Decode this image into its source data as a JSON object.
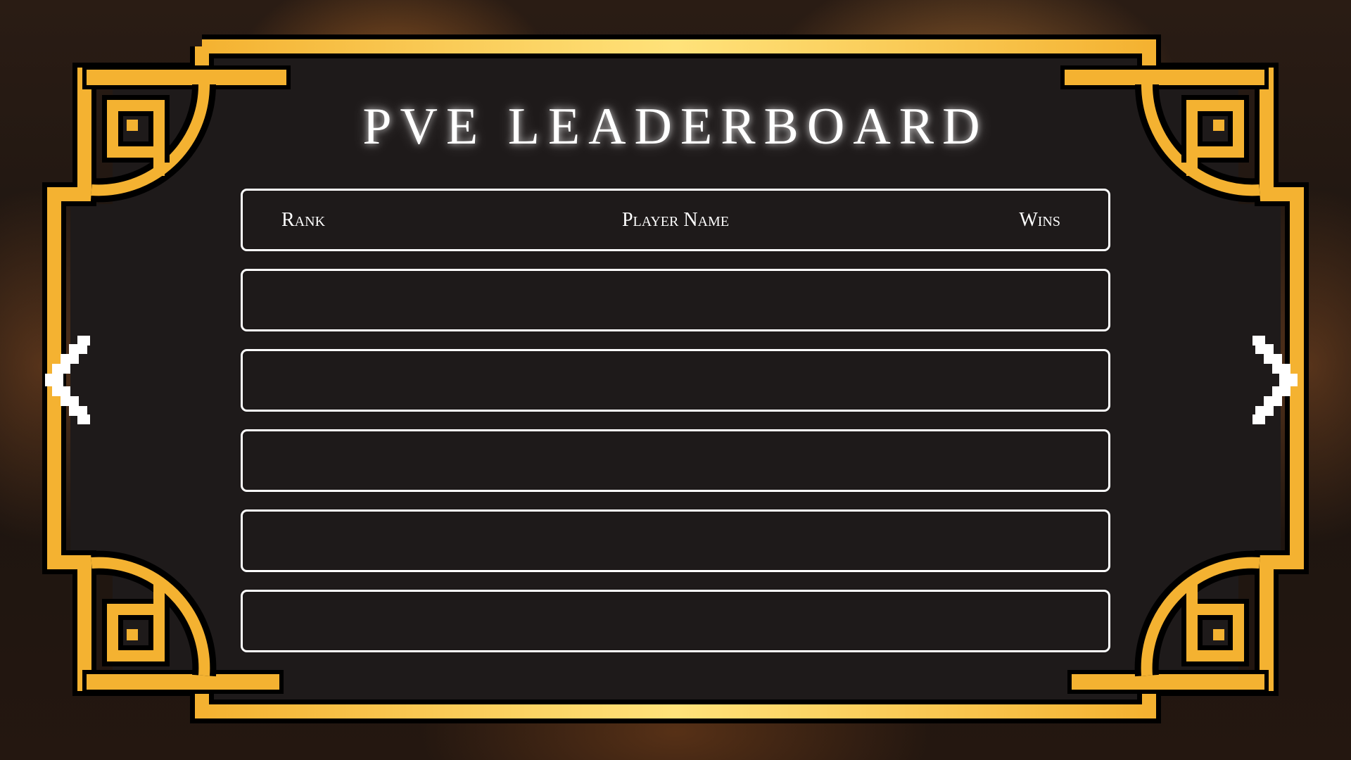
{
  "leaderboard": {
    "title": "PVE LEADERBOARD",
    "columns": {
      "rank": "Rank",
      "player_name": "Player Name",
      "wins": "Wins"
    },
    "rows": [
      {
        "rank": "",
        "player_name": "",
        "wins": ""
      },
      {
        "rank": "",
        "player_name": "",
        "wins": ""
      },
      {
        "rank": "",
        "player_name": "",
        "wins": ""
      },
      {
        "rank": "",
        "player_name": "",
        "wins": ""
      },
      {
        "rank": "",
        "player_name": "",
        "wins": ""
      }
    ]
  },
  "navigation": {
    "previous_icon": "pixel-chevron-left-icon",
    "next_icon": "pixel-chevron-right-icon"
  },
  "colors": {
    "frame_gold": "#f4b231",
    "frame_highlight": "#ffe27a",
    "panel": "#1e1a1a",
    "row_border": "#ffffff",
    "text": "#ffffff"
  }
}
